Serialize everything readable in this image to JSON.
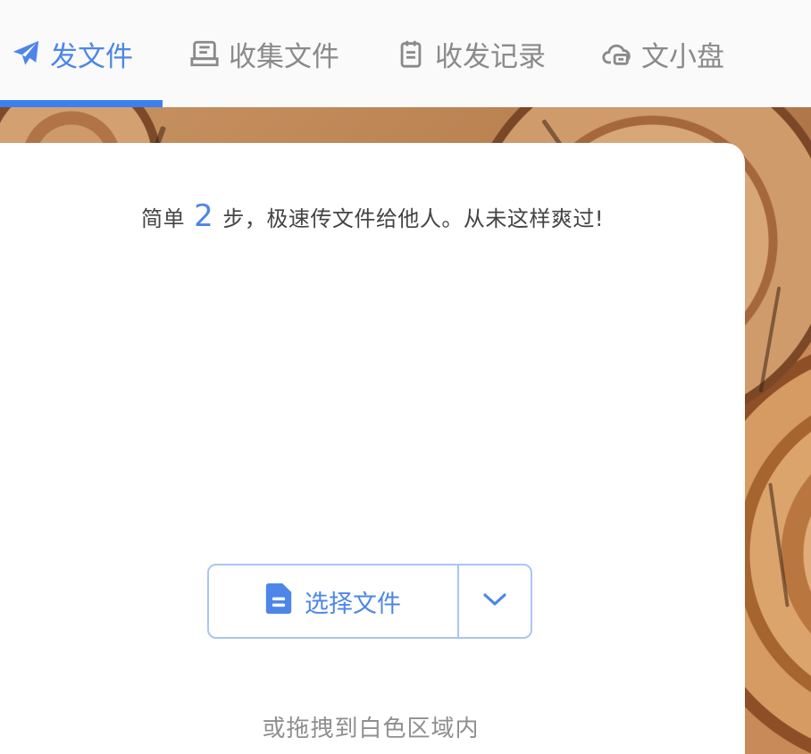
{
  "nav": {
    "tabs": [
      {
        "label": "发文件",
        "icon": "paper-plane-icon",
        "active": true
      },
      {
        "label": "收集文件",
        "icon": "inbox-icon",
        "active": false
      },
      {
        "label": "收发记录",
        "icon": "clipboard-icon",
        "active": false
      },
      {
        "label": "文小盘",
        "icon": "cloud-drive-icon",
        "active": false
      }
    ]
  },
  "hero": {
    "prefix": "简单",
    "step_count": "2",
    "suffix": "步，极速传文件给他人。从未这样爽过!"
  },
  "upload": {
    "select_label": "选择文件",
    "toggle_icon": "chevron-down-icon",
    "drag_hint": "或拖拽到白色区域内"
  },
  "colors": {
    "accent": "#4d86e8",
    "tab_inactive": "#8a8a8a",
    "button_border": "#a9c6f3"
  }
}
